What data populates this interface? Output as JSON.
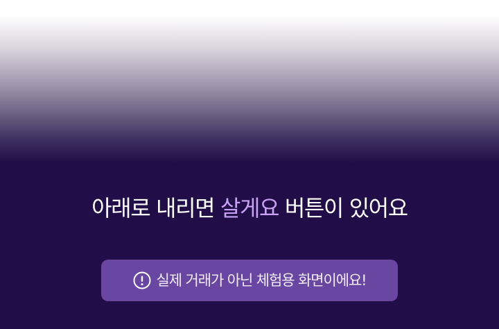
{
  "headline": {
    "prefix": "아래로 내리면 ",
    "highlight": "살게요",
    "suffix": " 버튼이 있어요"
  },
  "notice": {
    "icon": "exclamation-circle-icon",
    "text": "실제 거래가 아닌 체험용 화면이에요!"
  },
  "colors": {
    "background": "#210d47",
    "accent": "#c8a2f5",
    "notice_bg": "#6a46a3"
  }
}
